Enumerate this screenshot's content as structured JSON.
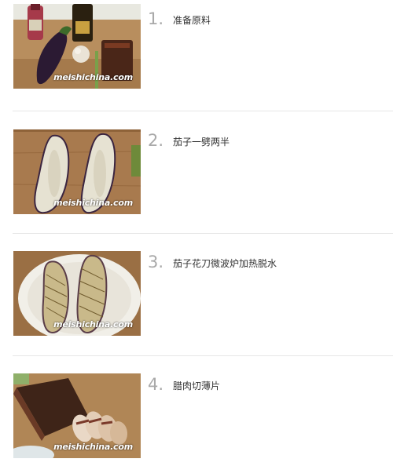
{
  "steps": [
    {
      "number": "1.",
      "text": "准备原料",
      "photo_icon": "ingredients-photo",
      "watermark": "meishichina.com"
    },
    {
      "number": "2.",
      "text": "茄子一劈两半",
      "photo_icon": "halved-eggplant-photo",
      "watermark": "meishichina.com"
    },
    {
      "number": "3.",
      "text": "茄子花刀微波炉加热脱水",
      "photo_icon": "scored-eggplant-plate-photo",
      "watermark": "meishichina.com"
    },
    {
      "number": "4.",
      "text": "腊肉切薄片",
      "photo_icon": "sliced-bacon-photo",
      "watermark": "meishichina.com"
    }
  ],
  "colors": {
    "step_number": "#a9a9a9",
    "step_text": "#333333",
    "divider": "#e6e6e6",
    "cutting_board": "#b08a5a"
  }
}
